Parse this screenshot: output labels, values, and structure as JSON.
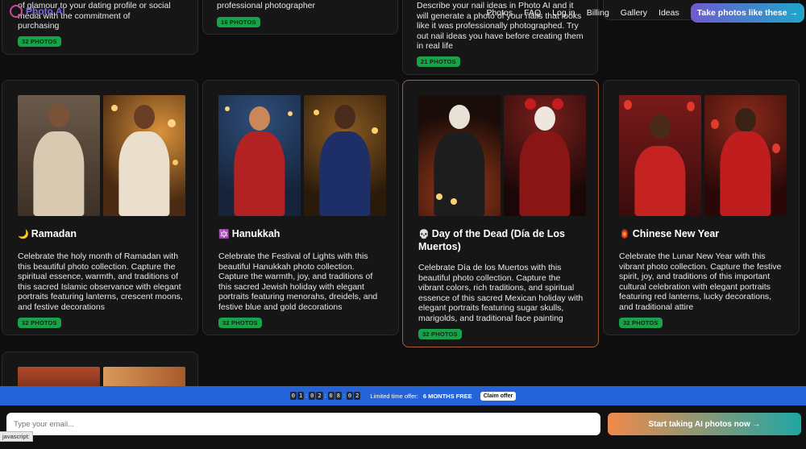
{
  "header": {
    "logo_text": "Photo AI",
    "nav": [
      "Photos",
      "FAQ",
      "Log in",
      "Billing",
      "Gallery",
      "Ideas"
    ],
    "cta": "Take photos like these →"
  },
  "top_cards": [
    {
      "desc_lines": [
        "of glamour to your dating profile or social",
        "media with the commitment of",
        "purchasing"
      ],
      "badge": "32 PHOTOS"
    },
    {
      "desc_lines": [
        "professional photographer"
      ],
      "badge": "16 PHOTOS"
    },
    {
      "desc_lines": [
        "Describe your nail ideas in Photo AI and it",
        "will generate a photo of your nails that looks",
        "like it was professionally photographed. Try",
        "out nail ideas you have before creating them",
        "in real life"
      ],
      "badge": "21 PHOTOS"
    }
  ],
  "cards": [
    {
      "emoji": "🌙",
      "title": "Ramadan",
      "description": "Celebrate the holy month of Ramadan with this beautiful photo collection. Capture the spiritual essence, warmth, and traditions of this sacred Islamic observance with elegant portraits featuring lanterns, crescent moons, and festive decorations",
      "badge": "32 PHOTOS"
    },
    {
      "emoji": "🔯",
      "title": "Hanukkah",
      "description": "Celebrate the Festival of Lights with this beautiful Hanukkah photo collection. Capture the warmth, joy, and traditions of this sacred Jewish holiday with elegant portraits featuring menorahs, dreidels, and festive blue and gold decorations",
      "badge": "32 PHOTOS"
    },
    {
      "emoji": "💀",
      "title": "Day of the Dead (Día de Los Muertos)",
      "description": "Celebrate Día de los Muertos with this beautiful photo collection. Capture the vibrant colors, rich traditions, and spiritual essence of this sacred Mexican holiday with elegant portraits featuring sugar skulls, marigolds, and traditional face painting",
      "badge": "32 PHOTOS"
    },
    {
      "emoji": "🏮",
      "title": "Chinese New Year",
      "description": "Celebrate the Lunar New Year with this vibrant photo collection. Capture the festive spirit, joy, and traditions of this important cultural celebration with elegant portraits featuring red lanterns, lucky decorations, and traditional attire",
      "badge": "32 PHOTOS"
    }
  ],
  "promo": {
    "timer_digits": [
      "0",
      "1",
      "0",
      "2",
      "0",
      "8",
      "0",
      "2"
    ],
    "label": "Limited time offer:",
    "offer": "6 MONTHS FREE",
    "claim": "Claim offer"
  },
  "signup": {
    "email_placeholder": "Type your email...",
    "button": "Start taking AI photos now →"
  },
  "status_text": "javascript:"
}
